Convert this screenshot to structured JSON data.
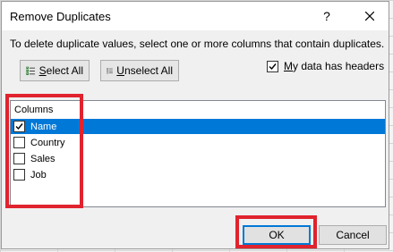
{
  "dialog": {
    "title": "Remove Duplicates",
    "help_glyph": "?",
    "close_icon": "close-icon",
    "instructions": "To delete duplicate values, select one or more columns that contain duplicates."
  },
  "toolbar": {
    "select_all_prefix": "",
    "select_all_mnemonic": "S",
    "select_all_rest": "elect All",
    "unselect_all_mnemonic": "U",
    "unselect_all_rest": "nselect All",
    "headers_mnemonic": "M",
    "headers_rest": "y data has headers",
    "headers_checked": true
  },
  "columns": {
    "header": "Columns",
    "items": [
      {
        "label": "Name",
        "checked": true,
        "selected": true
      },
      {
        "label": "Country",
        "checked": false,
        "selected": false
      },
      {
        "label": "Sales",
        "checked": false,
        "selected": false
      },
      {
        "label": "Job",
        "checked": false,
        "selected": false
      }
    ]
  },
  "buttons": {
    "ok": "OK",
    "cancel": "Cancel"
  },
  "colors": {
    "selection": "#0078d7",
    "highlight": "#e0232e"
  }
}
